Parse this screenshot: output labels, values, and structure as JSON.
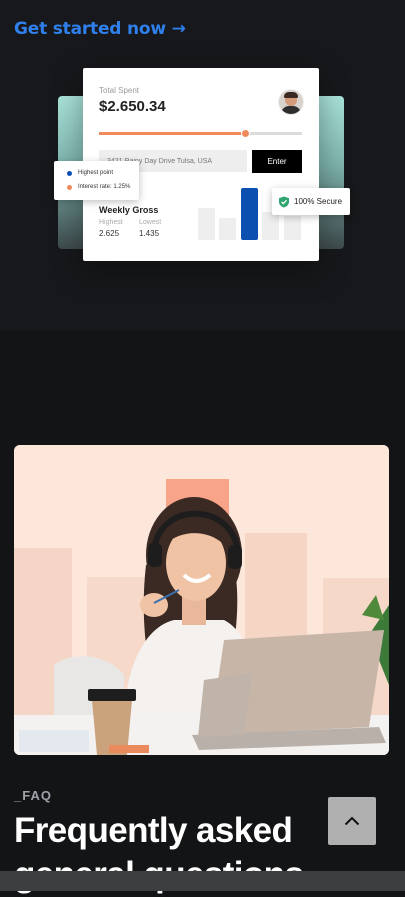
{
  "hero": {
    "cta_label": "Get started now →",
    "card": {
      "total_label": "Total Spent",
      "total_value": "$2.650.34",
      "slider_fraction": 0.72,
      "address_placeholder": "3421 Rainy Day Drive Tulsa, USA",
      "enter_label": "Enter",
      "weekly_title": "Weekly Gross",
      "highest_label": "Highest",
      "highest_value": "2.625",
      "lowest_label": "Lowest",
      "lowest_value": "1.435"
    },
    "legend": {
      "highest_point": "Highest point",
      "interest_rate": "Interest rate: 1.25%",
      "highest_color": "#0b4fb0",
      "interest_color": "#f08a5d"
    },
    "secure_label": "100% Secure"
  },
  "faq": {
    "eyebrow": "_FAQ",
    "title": "Frequently asked general questions"
  },
  "colors": {
    "accent": "#2f80ed",
    "background": "#131416",
    "bar_active": "#0b4fb0",
    "slider": "#f08a5d"
  }
}
